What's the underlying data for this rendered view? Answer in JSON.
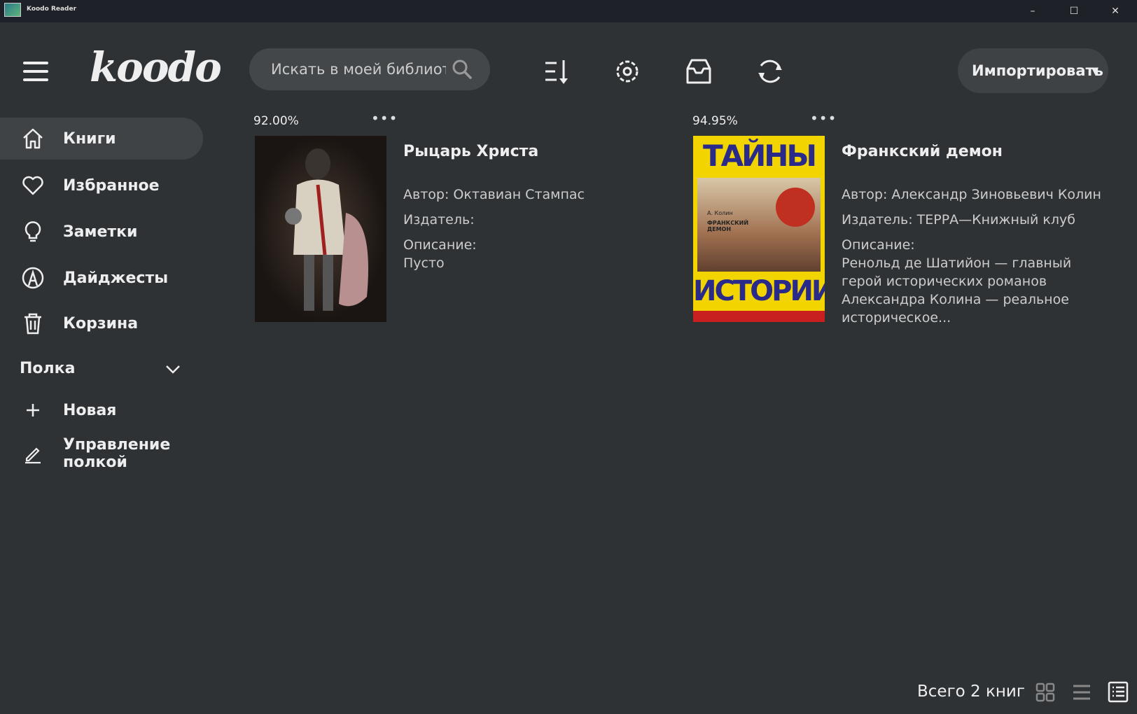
{
  "window": {
    "title": "Koodo Reader",
    "controls": [
      "minimize",
      "maximize",
      "close"
    ]
  },
  "header": {
    "logo": "koodo",
    "search_placeholder": "Искать в моей библиотеке",
    "tools": [
      "sort-icon",
      "settings-icon",
      "inbox-icon",
      "sync-icon"
    ],
    "import_label": "Импортировать"
  },
  "sidebar": {
    "items": [
      {
        "label": "Книги",
        "icon": "home-icon",
        "active": true
      },
      {
        "label": "Избранное",
        "icon": "heart-icon"
      },
      {
        "label": "Заметки",
        "icon": "lightbulb-icon"
      },
      {
        "label": "Дайджесты",
        "icon": "highlight-icon"
      },
      {
        "label": "Корзина",
        "icon": "trash-icon"
      }
    ],
    "shelf_label": "Полка",
    "new_label": "Новая",
    "manage_label": "Управление полкой"
  },
  "books": [
    {
      "progress": "92.00%",
      "title": "Рыцарь Христа",
      "author": "Автор: Октавиан Стампас",
      "publisher": "Издатель:",
      "desc_label": "Описание:",
      "desc": "Пусто"
    },
    {
      "progress": "94.95%",
      "title": "Франкский демон",
      "author": "Автор: Александр Зиновьевич Колин",
      "publisher": "Издатель: ТЕРРА—Книжный клуб",
      "desc_label": "Описание:",
      "desc": "Ренольд де Шатийон — главный герой исторических романов Александра Колина — реальное историческое...",
      "cover_text_top": "ТАЙНЫ",
      "cover_text_bottom": "ИСТОРИИ",
      "cover_author": "А. Колин",
      "cover_title": "ФРАНКСКИЙ ДЕМОН"
    }
  ],
  "footer": {
    "count": "Всего 2 книг",
    "view_modes": [
      "grid",
      "list",
      "detail"
    ],
    "active_view": "detail"
  },
  "colors": {
    "background": "#2e3235",
    "titlebar": "#1e2127",
    "active": "#3f4346"
  }
}
